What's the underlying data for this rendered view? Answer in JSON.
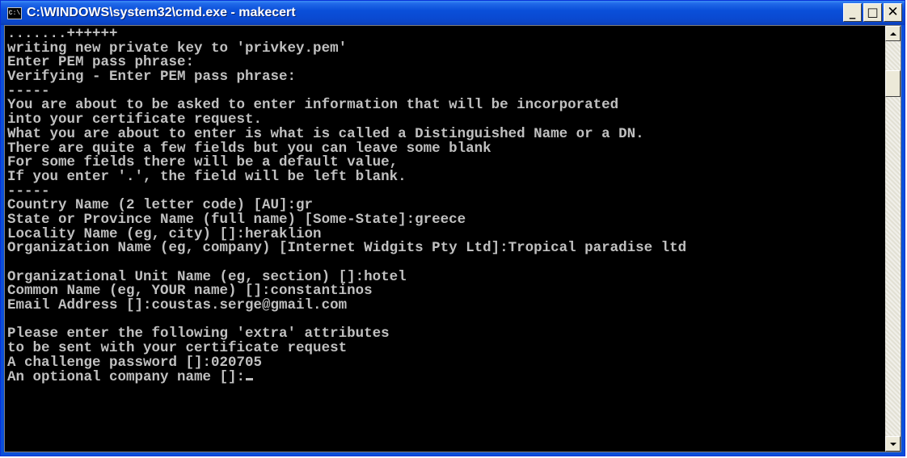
{
  "window": {
    "title": "C:\\WINDOWS\\system32\\cmd.exe - makecert",
    "app_icon_text": "C:\\"
  },
  "controls": {
    "minimize_icon": "minimize-icon",
    "maximize_icon": "maximize-icon",
    "close_icon": "close-icon",
    "minimize": "_",
    "maximize": "□",
    "close": "✕"
  },
  "console": {
    "lines": [
      ".......++++++",
      "writing new private key to 'privkey.pem'",
      "Enter PEM pass phrase:",
      "Verifying - Enter PEM pass phrase:",
      "-----",
      "You are about to be asked to enter information that will be incorporated",
      "into your certificate request.",
      "What you are about to enter is what is called a Distinguished Name or a DN.",
      "There are quite a few fields but you can leave some blank",
      "For some fields there will be a default value,",
      "If you enter '.', the field will be left blank.",
      "-----",
      "Country Name (2 letter code) [AU]:gr",
      "State or Province Name (full name) [Some-State]:greece",
      "Locality Name (eg, city) []:heraklion",
      "Organization Name (eg, company) [Internet Widgits Pty Ltd]:Tropical paradise ltd",
      "",
      "Organizational Unit Name (eg, section) []:hotel",
      "Common Name (eg, YOUR name) []:constantinos",
      "Email Address []:coustas.serge@gmail.com",
      "",
      "Please enter the following 'extra' attributes",
      "to be sent with your certificate request",
      "A challenge password []:020705",
      "An optional company name []:"
    ]
  },
  "colors": {
    "titlebar": "#0a4fd9",
    "console_bg": "#000000",
    "console_fg": "#c0c0c0"
  }
}
